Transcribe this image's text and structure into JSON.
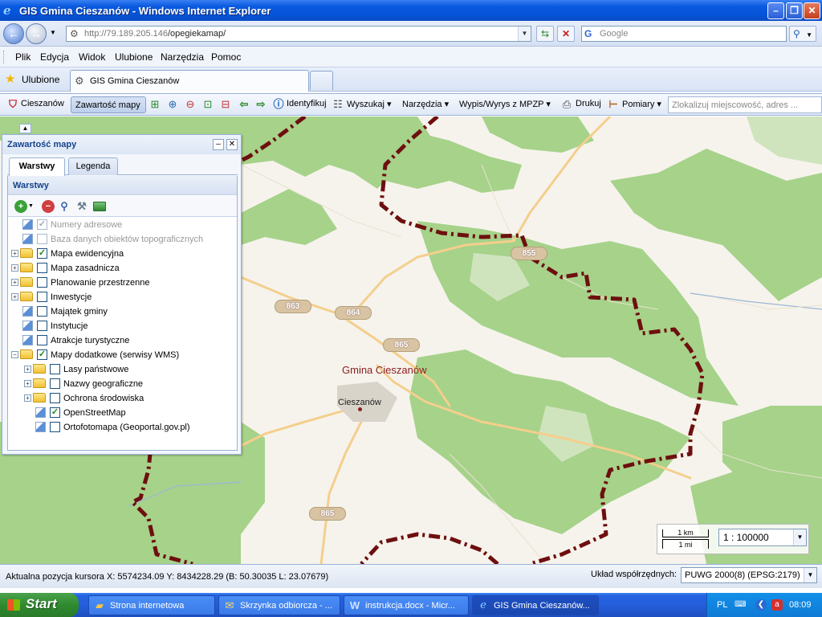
{
  "window": {
    "title": "GIS Gmina Cieszanów - Windows Internet Explorer",
    "minimize": "–",
    "maximize": "❐",
    "close": "✕"
  },
  "address": {
    "url_host": "http://79.189.205.146",
    "url_path": "/opegiekamap/",
    "search_placeholder": "Google",
    "search_engine_glyph": "G"
  },
  "menu": {
    "items": [
      "Plik",
      "Edycja",
      "Widok",
      "Ulubione",
      "Narzędzia",
      "Pomoc"
    ]
  },
  "favorites": {
    "label": "Ulubione",
    "tab_title": "GIS Gmina Cieszanów"
  },
  "app_toolbar": {
    "home": "Cieszanów",
    "contents": "Zawartość mapy",
    "identify": "Identyfikuj",
    "search": "Wyszukaj",
    "tools": "Narzędzia",
    "mpzp": "Wypis/Wyrys z MPZP",
    "print": "Drukuj",
    "measure": "Pomiary",
    "locate_placeholder": "Zlokalizuj miejscowość, adres ..."
  },
  "panel": {
    "title": "Zawartość mapy",
    "tabs": [
      "Warstwy",
      "Legenda"
    ],
    "active_tab": "Warstwy",
    "section_title": "Warstwy",
    "layers": [
      {
        "label": "Numery adresowe",
        "checked": true,
        "disabled": true,
        "type": "leaf",
        "level": 0
      },
      {
        "label": "Baza danych obiektów topograficznych",
        "checked": false,
        "disabled": true,
        "type": "leaf",
        "level": 0
      },
      {
        "label": "Mapa ewidencyjna",
        "checked": true,
        "disabled": false,
        "type": "group",
        "expanded": false,
        "level": 0
      },
      {
        "label": "Mapa zasadnicza",
        "checked": false,
        "disabled": false,
        "type": "group",
        "expanded": false,
        "level": 0
      },
      {
        "label": "Planowanie przestrzenne",
        "checked": false,
        "disabled": false,
        "type": "group",
        "expanded": false,
        "level": 0
      },
      {
        "label": "Inwestycje",
        "checked": false,
        "disabled": false,
        "type": "group",
        "expanded": false,
        "level": 0
      },
      {
        "label": "Majątek gminy",
        "checked": false,
        "disabled": false,
        "type": "leaf",
        "level": 0
      },
      {
        "label": "Instytucje",
        "checked": false,
        "disabled": false,
        "type": "leaf",
        "level": 0
      },
      {
        "label": "Atrakcje turystyczne",
        "checked": false,
        "disabled": false,
        "type": "leaf",
        "level": 0
      },
      {
        "label": "Mapy dodatkowe (serwisy WMS)",
        "checked": true,
        "disabled": false,
        "type": "group",
        "expanded": true,
        "level": 0
      },
      {
        "label": "Lasy państwowe",
        "checked": false,
        "disabled": false,
        "type": "group",
        "expanded": false,
        "level": 1
      },
      {
        "label": "Nazwy geograficzne",
        "checked": false,
        "disabled": false,
        "type": "group",
        "expanded": false,
        "level": 1
      },
      {
        "label": "Ochrona środowiska",
        "checked": false,
        "disabled": false,
        "type": "group",
        "expanded": false,
        "level": 1
      },
      {
        "label": "OpenStreetMap",
        "checked": true,
        "disabled": false,
        "type": "leaf",
        "level": 1
      },
      {
        "label": "Ortofotomapa (Geoportal.gov.pl)",
        "checked": false,
        "disabled": false,
        "type": "leaf",
        "level": 1
      }
    ]
  },
  "map": {
    "gmina_label": "Gmina Cieszanów",
    "town_label": "Cieszanów",
    "roads": [
      "855",
      "863",
      "864",
      "865",
      "865"
    ],
    "colors": {
      "forest": "#a6d28a",
      "background": "#f6f3ec",
      "border": "#6e0f0f",
      "road": "#f7d9a0"
    }
  },
  "scale": {
    "km": "1 km",
    "mi": "1 mi",
    "value": "1 : 100000"
  },
  "status": {
    "cursor": "Aktualna pozycja kursora X: 5574234.09 Y: 8434228.29 (B: 50.30035 L: 23.07679)",
    "crs_label": "Układ współrzędnych:",
    "crs_value": "PUWG 2000(8) (EPSG:2179)"
  },
  "taskbar": {
    "start": "Start",
    "tasks": [
      {
        "label": "Strona internetowa",
        "icon": "folder-icon"
      },
      {
        "label": "Skrzynka odbiorcza - ...",
        "icon": "outlook-icon"
      },
      {
        "label": "instrukcja.docx - Micr...",
        "icon": "word-icon"
      },
      {
        "label": "GIS Gmina Cieszanów...",
        "icon": "ie-icon"
      }
    ],
    "language": "PL",
    "clock": "08:09"
  }
}
